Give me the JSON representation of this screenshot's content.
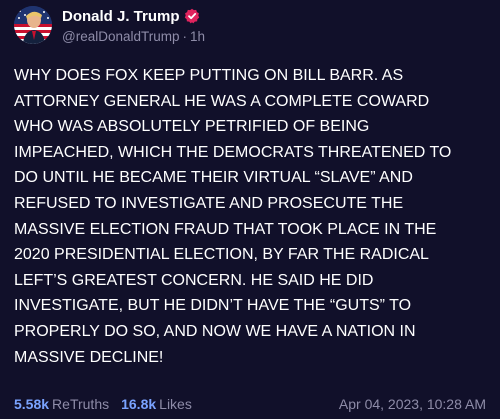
{
  "author": {
    "display_name": "Donald J. Trump",
    "handle": "@realDonaldTrump",
    "time_ago": "1h",
    "separator": "·"
  },
  "post": {
    "lines": [
      "WHY DOES FOX KEEP PUTTING ON BILL BARR. AS",
      "ATTORNEY GENERAL HE WAS A COMPLETE COWARD",
      "WHO WAS ABSOLUTELY PETRIFIED OF BEING",
      "IMPEACHED, WHICH THE DEMOCRATS THREATENED TO",
      "DO UNTIL HE BECAME THEIR VIRTUAL “SLAVE” AND",
      "REFUSED TO INVESTIGATE AND PROSECUTE THE",
      "MASSIVE ELECTION FRAUD THAT TOOK PLACE IN THE",
      "2020 PRESIDENTIAL ELECTION, BY FAR THE RADICAL",
      "LEFT’S GREATEST CONCERN. HE SAID HE DID",
      "INVESTIGATE, BUT HE DIDN’T HAVE THE “GUTS” TO",
      "PROPERLY DO SO, AND NOW WE HAVE A NATION IN",
      "MASSIVE DECLINE!"
    ]
  },
  "footer": {
    "retruths_count": "5.58k",
    "retruths_label": "ReTruths",
    "likes_count": "16.8k",
    "likes_label": "Likes",
    "timestamp": "Apr 04, 2023, 10:28 AM"
  },
  "colors": {
    "background": "#11102a",
    "accent": "#7aa3ff",
    "muted": "#8e8ca8",
    "verified": "#e0245e"
  },
  "icons": {
    "avatar": "avatar-image",
    "verified": "verified-badge-icon"
  }
}
